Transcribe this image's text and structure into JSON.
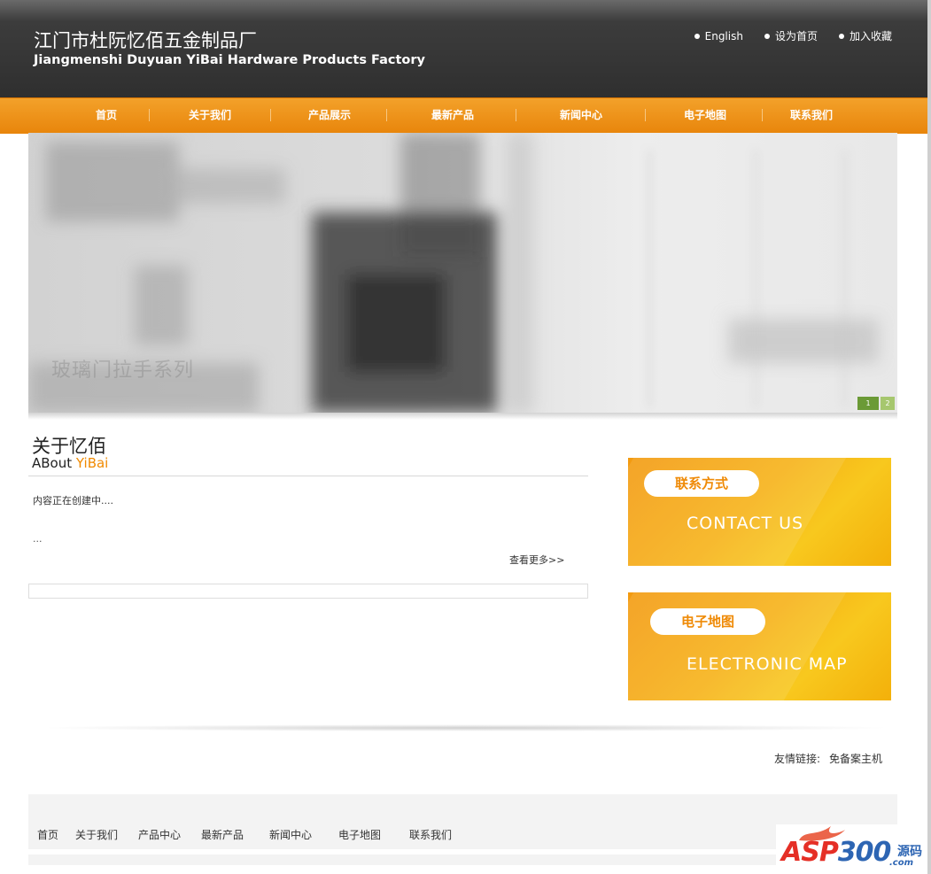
{
  "header": {
    "title_cn": "江门市杜阮忆佰五金制品厂",
    "title_en": "Jiangmenshi Duyuan YiBai Hardware Products Factory",
    "top_links": [
      "English",
      "设为首页",
      "加入收藏"
    ]
  },
  "nav": {
    "items": [
      "首页",
      "关于我们",
      "产品展示",
      "最新产品",
      "新闻中心",
      "电子地图",
      "联系我们"
    ]
  },
  "banner": {
    "caption": "玻璃门拉手系列",
    "pager": [
      "1",
      "2"
    ]
  },
  "about": {
    "title": "关于忆佰",
    "subtitle_prefix": "ABout",
    "subtitle_accent": "YiBai",
    "body": "内容正在创建中....",
    "ellipsis": "...",
    "more": "查看更多>>"
  },
  "cards": {
    "contact": {
      "pill": "联系方式",
      "en": "CONTACT US"
    },
    "map": {
      "pill": "电子地图",
      "en": "ELECTRONIC MAP"
    }
  },
  "friend_links": {
    "label": "友情链接:",
    "links": [
      "免备案主机"
    ]
  },
  "footer": {
    "nav": [
      "首页",
      "关于我们",
      "产品中心",
      "最新产品",
      "新闻中心",
      "电子地图",
      "联系我们"
    ]
  },
  "watermark": {
    "asp": "ASP",
    "num": "300",
    "cn": "源码",
    "com": ".com"
  },
  "colors": {
    "header_bg": "#3a3a3a",
    "nav_orange": "#ef8c0d",
    "accent": "#f18a00",
    "card_yellow": "#f6b218"
  }
}
